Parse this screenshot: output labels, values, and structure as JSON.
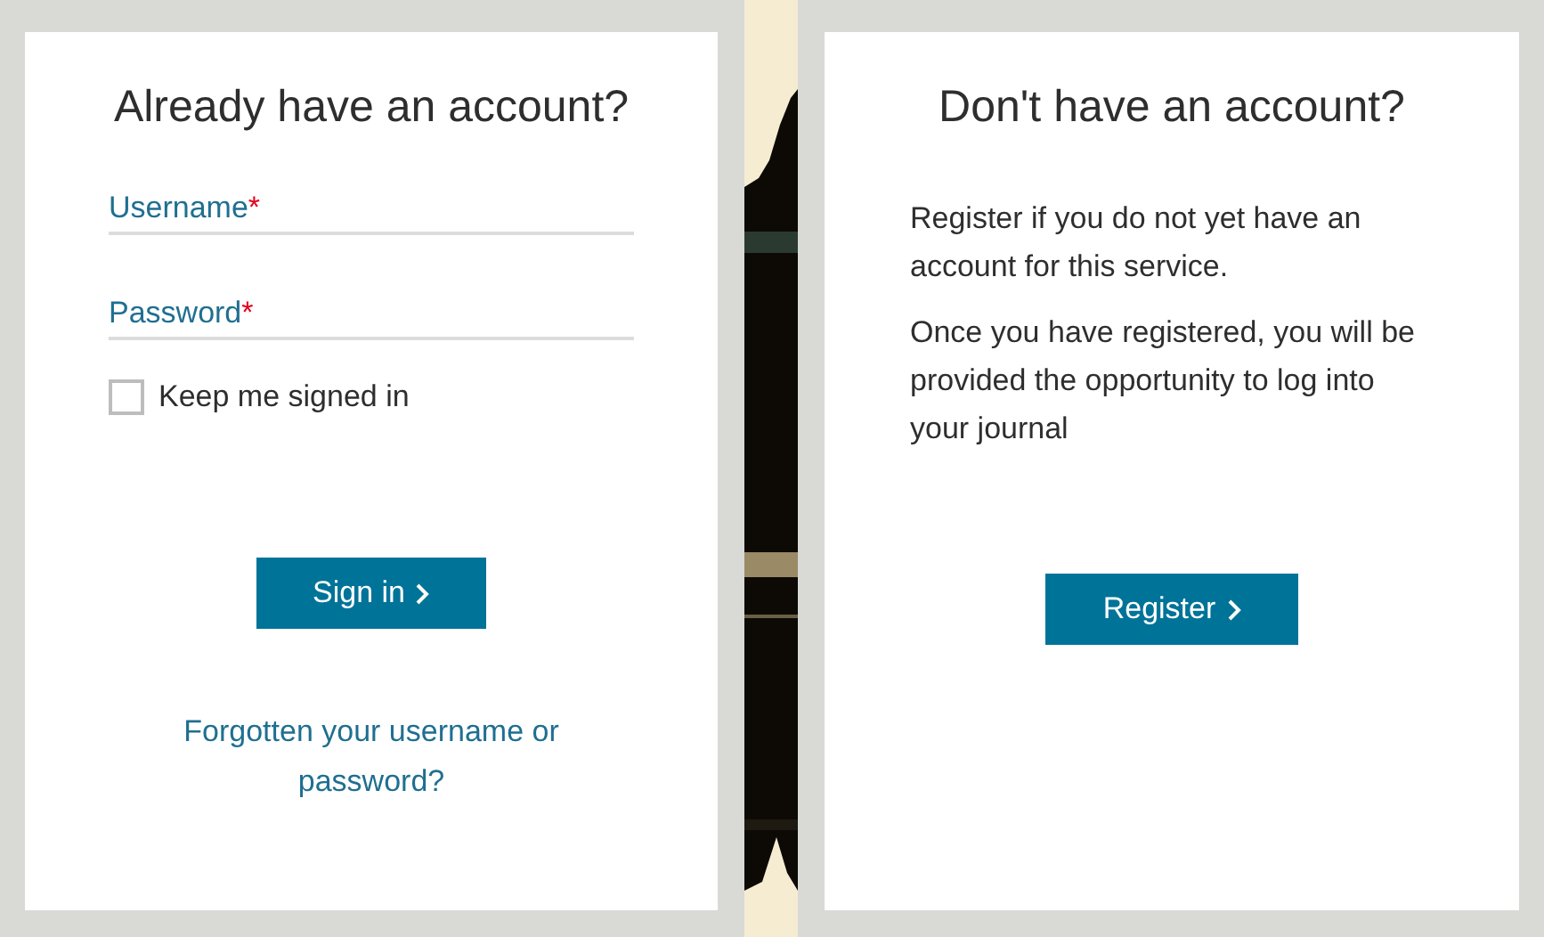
{
  "sign_in": {
    "title": "Already have an account?",
    "fields": [
      {
        "label": "Username",
        "required_mark": "*"
      },
      {
        "label": "Password",
        "required_mark": "*"
      }
    ],
    "keep_signed_in": {
      "label": "Keep me signed in",
      "checked": false
    },
    "button": "Sign in",
    "forgot_link": "Forgotten your username or password?"
  },
  "register": {
    "title": "Don't have an account?",
    "paragraphs": [
      "Register if you do not yet have an account for this service.",
      "Once you have registered, you will be provided the opportunity to log into your journal"
    ],
    "button": "Register"
  }
}
